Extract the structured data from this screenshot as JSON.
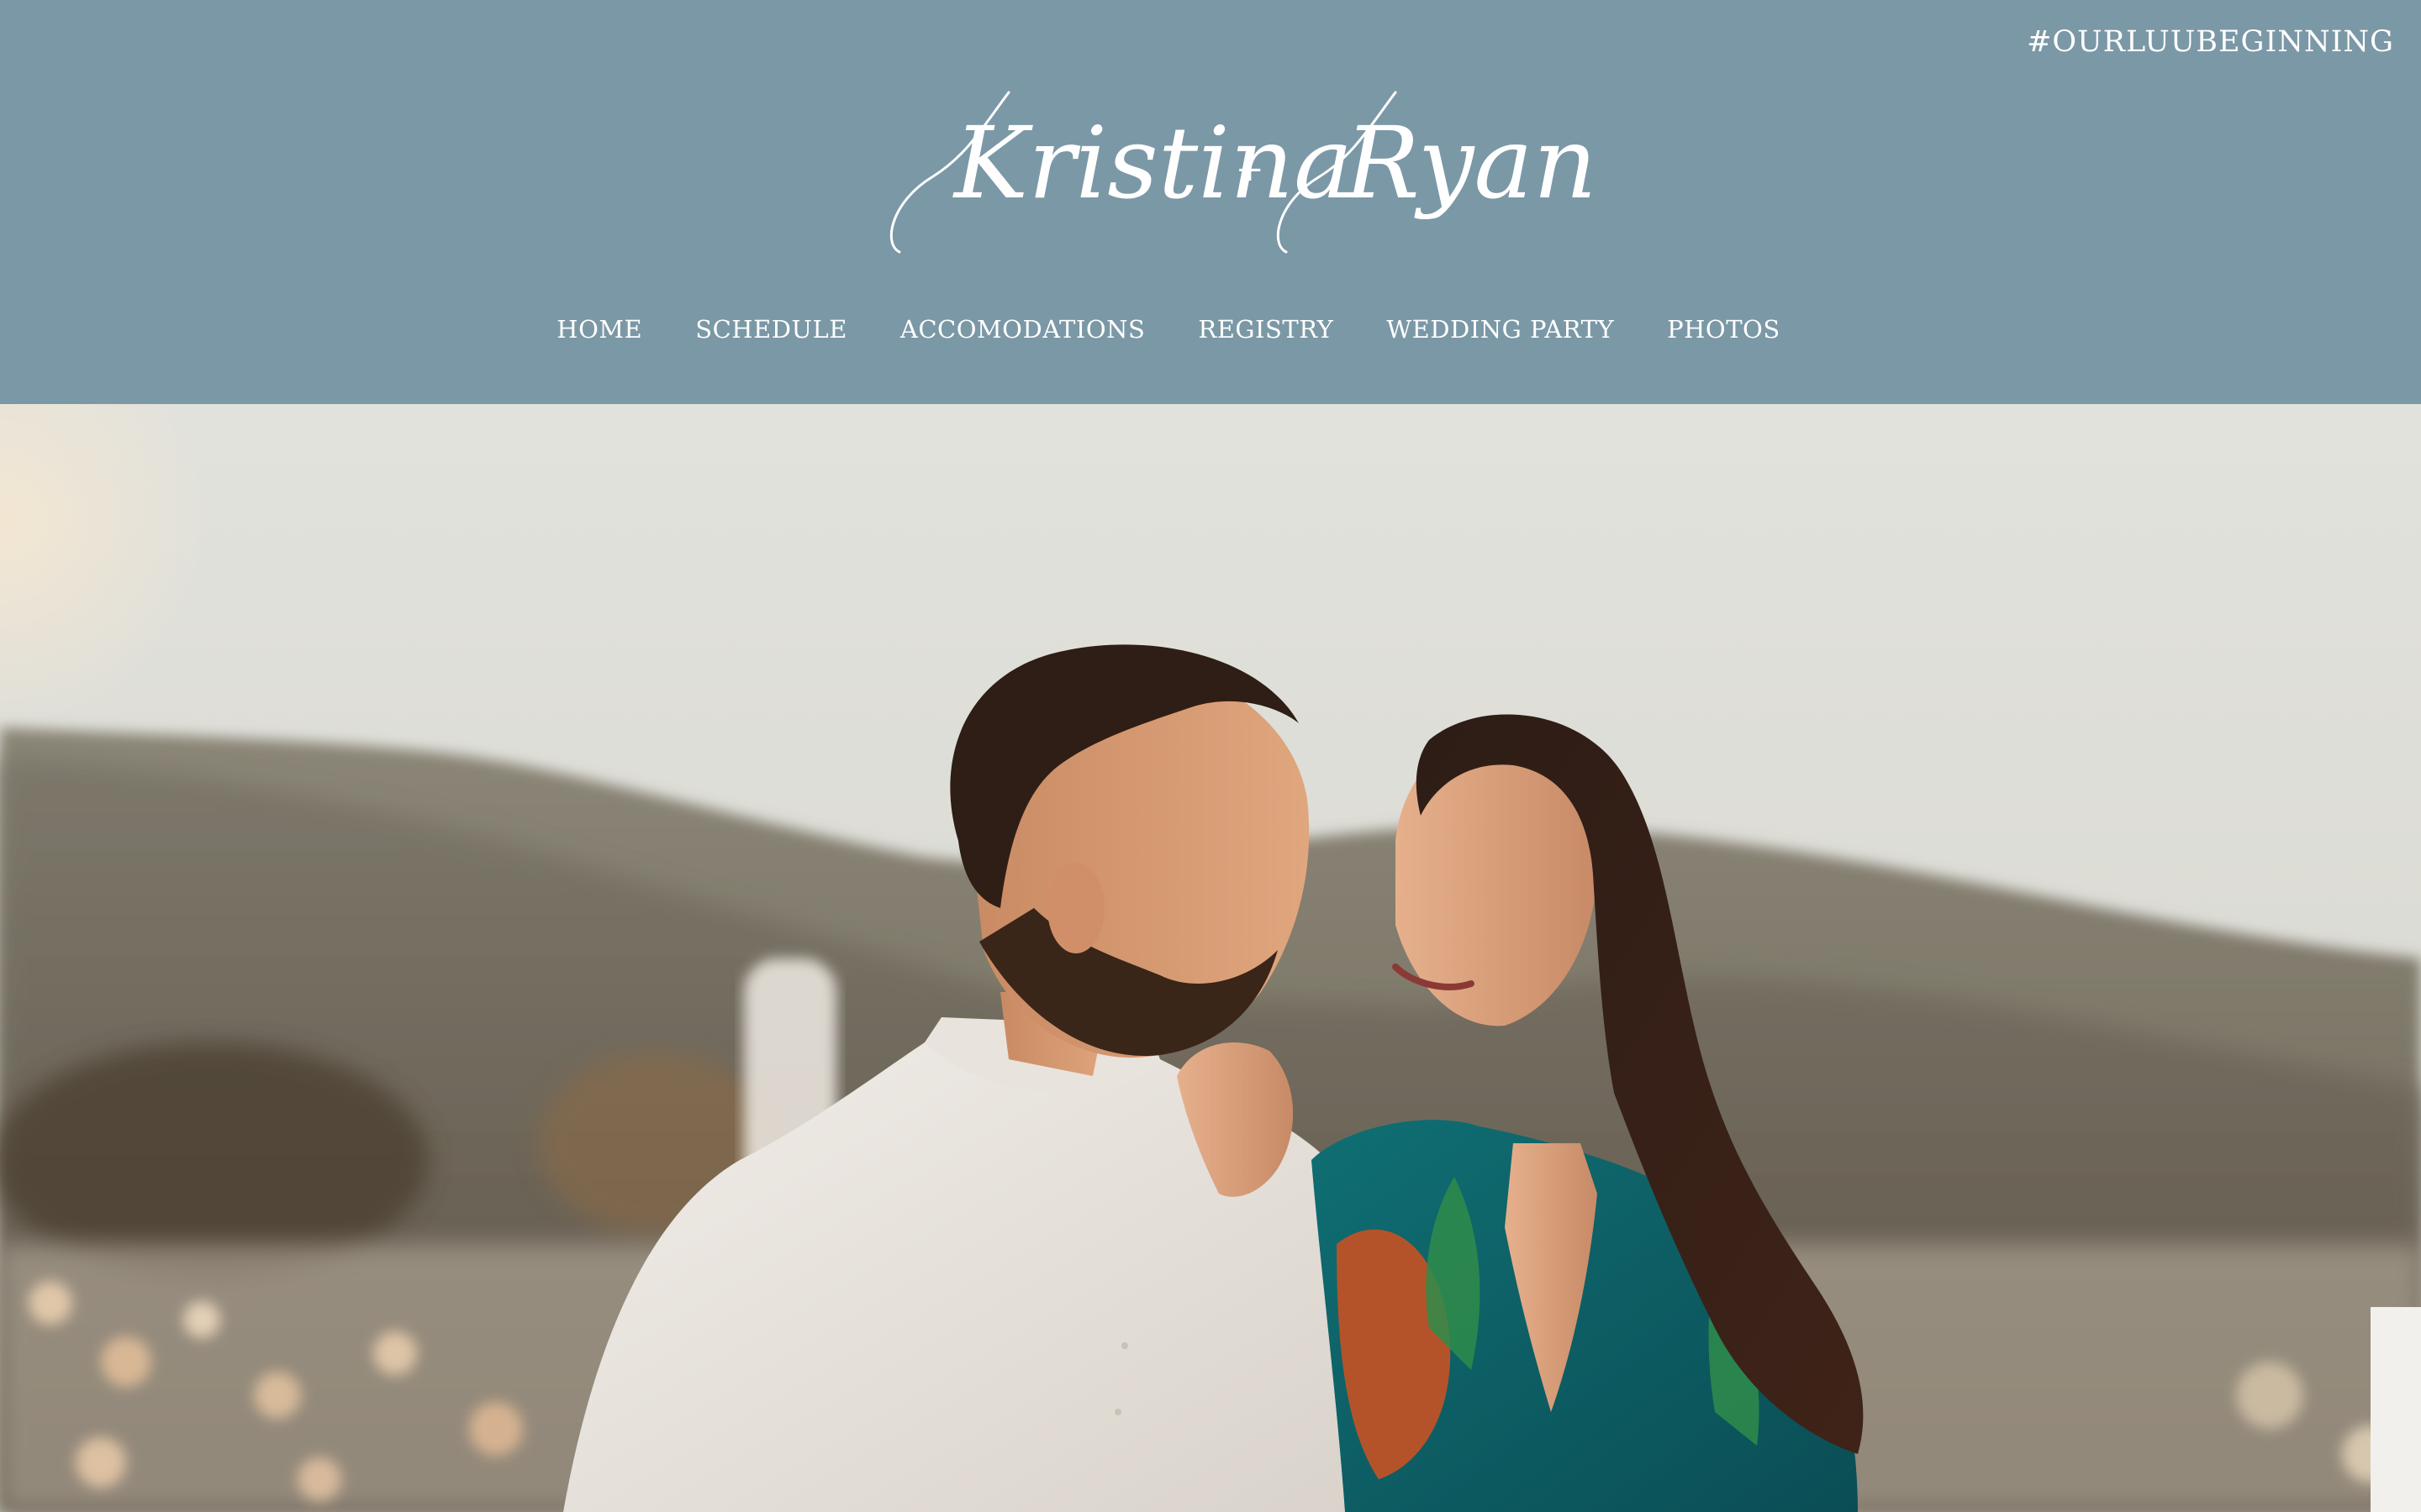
{
  "header": {
    "hashtag": "#OURLUUBEGINNING",
    "logo": {
      "name_left": "Kristina",
      "connector": "+",
      "name_right": "Ryan"
    },
    "nav": {
      "items": [
        {
          "label": "HOME"
        },
        {
          "label": "SCHEDULE"
        },
        {
          "label": "ACCOMODATIONS"
        },
        {
          "label": "REGISTRY"
        },
        {
          "label": "WEDDING PARTY"
        },
        {
          "label": "PHOTOS"
        }
      ]
    }
  },
  "colors": {
    "header_bg": "#7b98a6",
    "header_text": "#ffffff",
    "sky": "#dfdfd9",
    "hills": "#6f6a5c"
  },
  "hero": {
    "image": "engagement-photo"
  }
}
